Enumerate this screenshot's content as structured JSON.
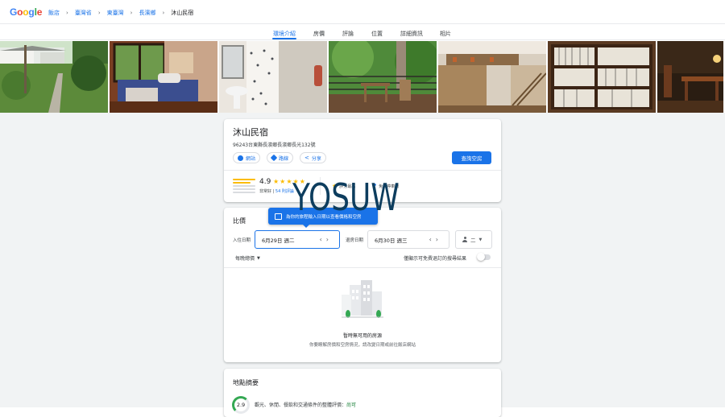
{
  "logo": {
    "letters": [
      "G",
      "o",
      "o",
      "g",
      "l",
      "e"
    ],
    "colors": [
      "#4285F4",
      "#EA4335",
      "#FBBC05",
      "#4285F4",
      "#34A853",
      "#EA4335"
    ]
  },
  "breadcrumb": [
    "飯店",
    "臺灣省",
    "東臺灣",
    "長濱鄉",
    "沐山民宿"
  ],
  "tabs": [
    "環境介紹",
    "房價",
    "評論",
    "位置",
    "詳細資訊",
    "相片"
  ],
  "active_tab": "環境介紹",
  "photos": [
    "garden-house",
    "bedroom",
    "bathroom",
    "balcony",
    "loft-living-room",
    "bookshelf",
    "dining-room"
  ],
  "hotel": {
    "name": "沐山民宿",
    "address": "96243台東縣長濱鄉長濱鄉長光132號",
    "actions": {
      "website": "網站",
      "route": "路線",
      "share": "分享"
    },
    "book_label": "查詢空房",
    "rating": "4.9",
    "stars": "★★★★★",
    "rating_word": "非常好",
    "reviews_link": "54 則評論",
    "amenity_1": "評分最高",
    "amenity_2": "免費停車場"
  },
  "price": {
    "title": "比價",
    "tooltip": "為你的旅程輸入日期以查看價格和空房",
    "checkin_label": "入住日期",
    "checkin_value": "6月29日 週二",
    "checkout_label": "退房日期",
    "checkout_value": "6月30日 週三",
    "guests": "二",
    "per_night": "每晚總價",
    "free_cancel": "僅顯示可免費退訂的搜尋結果",
    "empty_title": "暫時無可用的房源",
    "empty_sub": "你要瞭解房價和空房情況，請改變日期或前往飯店網站"
  },
  "location": {
    "title": "地點摘要",
    "score": "2.9",
    "desc": "觀光、休閒、餐飲和交通條件的整體評價：",
    "desc_link": "尚可"
  },
  "watermark": "YOSUW"
}
